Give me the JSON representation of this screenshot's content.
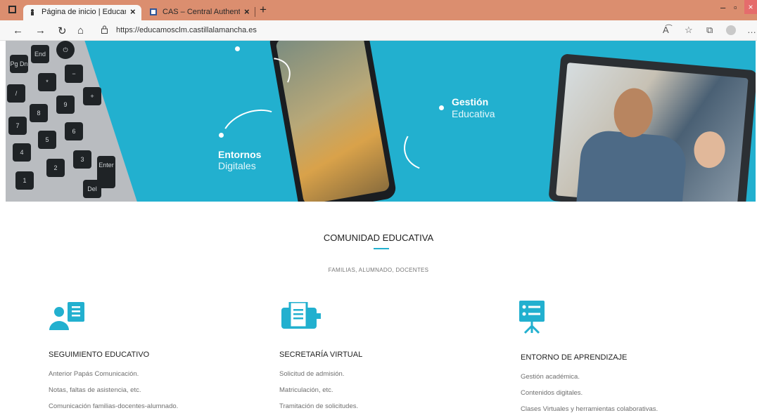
{
  "browser": {
    "tabs": [
      {
        "title": "Página de inicio | EducamosCLM",
        "active": true
      },
      {
        "title": "CAS – Central Authentication Se",
        "active": false
      }
    ],
    "url": "https://educamosclm.castillalamancha.es",
    "toolbar_icons": [
      "read-aloud-icon",
      "favorites-icon",
      "collections-icon",
      "profile-icon",
      "more-icon"
    ]
  },
  "hero": {
    "label1_bold": "Entornos",
    "label1_light": "Digitales",
    "label2_bold": "Gestión",
    "label2_light": "Educativa",
    "accent_color": "#22b0cf"
  },
  "community": {
    "title": "COMUNIDAD EDUCATIVA",
    "subtitle": "FAMILIAS, ALUMNADO, DOCENTES",
    "columns": [
      {
        "icon": "user-document-icon",
        "title": "SEGUIMIENTO EDUCATIVO",
        "items": [
          "Anterior Papás Comunicación.",
          "Notas, faltas de asistencia, etc.",
          "Comunicación familias-docentes-alumnado."
        ]
      },
      {
        "icon": "printer-document-icon",
        "title": "SECRETARÍA VIRTUAL",
        "items": [
          "Solicitud de admisión.",
          "Matriculación, etc.",
          "Tramitación de solicitudes."
        ]
      },
      {
        "icon": "presentation-board-icon",
        "title": "ENTORNO DE APRENDIZAJE",
        "items": [
          "Gestión académica.",
          "Contenidos digitales.",
          "Clases Virtuales y herramientas colaborativas."
        ]
      }
    ]
  }
}
